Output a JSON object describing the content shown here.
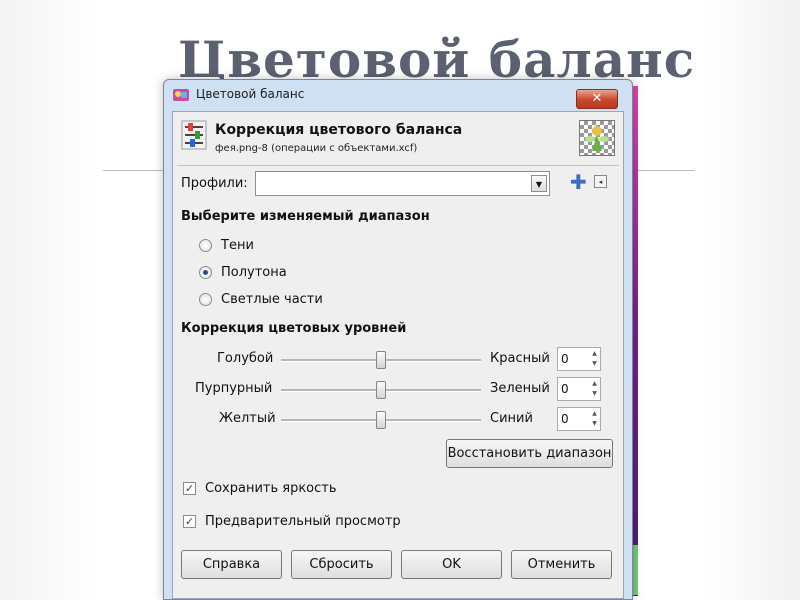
{
  "slide": {
    "title": "Цветовой баланс"
  },
  "window": {
    "title": "Цветовой баланс",
    "close_glyph": "✕",
    "header_title": "Коррекция цветового баланса",
    "header_subtitle": "фея.png-8 (операции с объектами.xcf)"
  },
  "profiles": {
    "label": "Профили:",
    "value": "",
    "add_glyph": "✚",
    "menu_glyph": "◂"
  },
  "range": {
    "heading": "Выберите изменяемый диапазон",
    "options": [
      {
        "label": "Тени",
        "checked": false
      },
      {
        "label": "Полутона",
        "checked": true
      },
      {
        "label": "Светлые части",
        "checked": false
      }
    ]
  },
  "levels": {
    "heading": "Коррекция цветовых уровней",
    "rows": [
      {
        "left": "Голубой",
        "right": "Красный",
        "value": "0",
        "position": 0.5
      },
      {
        "left": "Пурпурный",
        "right": "Зеленый",
        "value": "0",
        "position": 0.5
      },
      {
        "left": "Желтый",
        "right": "Синий",
        "value": "0",
        "position": 0.5
      }
    ],
    "reset_range_label": "Восстановить диапазон"
  },
  "options": {
    "preserve_luminosity": {
      "label": "Сохранить яркость",
      "checked": true
    },
    "preview": {
      "label": "Предварительный просмотр",
      "checked": true
    }
  },
  "buttons": {
    "help": "Справка",
    "reset": "Сбросить",
    "ok": "OK",
    "cancel": "Отменить"
  },
  "glyphs": {
    "check": "✓",
    "down": "▼",
    "spin_up": "▲",
    "spin_down": "▼"
  }
}
